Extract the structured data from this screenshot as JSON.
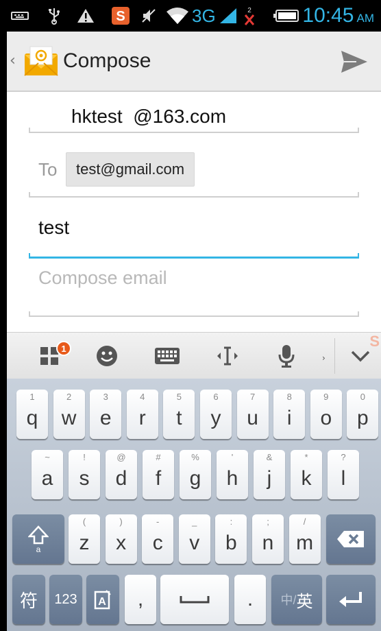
{
  "status_bar": {
    "network": "3G",
    "time": "10:45",
    "ampm": "AM"
  },
  "action_bar": {
    "title": "Compose",
    "app_icon": "email-app-icon",
    "action_icon": "send-icon"
  },
  "compose": {
    "from": "hktest  @163.com",
    "to_label": "To",
    "to_recipient": "test@gmail.com",
    "subject_value": "test",
    "body_placeholder": "Compose email"
  },
  "keyboard_toolbar": {
    "badge_count": "1",
    "tools": [
      "apps-icon",
      "emoji-icon",
      "keyboard-icon",
      "cursor-icon",
      "mic-icon",
      "chevron-down-icon"
    ]
  },
  "keyboard": {
    "row1": [
      {
        "sub": "1",
        "key": "q"
      },
      {
        "sub": "2",
        "key": "w"
      },
      {
        "sub": "3",
        "key": "e"
      },
      {
        "sub": "4",
        "key": "r"
      },
      {
        "sub": "5",
        "key": "t"
      },
      {
        "sub": "6",
        "key": "y"
      },
      {
        "sub": "7",
        "key": "u"
      },
      {
        "sub": "8",
        "key": "i"
      },
      {
        "sub": "9",
        "key": "o"
      },
      {
        "sub": "0",
        "key": "p"
      }
    ],
    "row2": [
      {
        "sub": "~",
        "key": "a"
      },
      {
        "sub": "!",
        "key": "s"
      },
      {
        "sub": "@",
        "key": "d"
      },
      {
        "sub": "#",
        "key": "f"
      },
      {
        "sub": "%",
        "key": "g"
      },
      {
        "sub": "'",
        "key": "h"
      },
      {
        "sub": "&",
        "key": "j"
      },
      {
        "sub": "*",
        "key": "k"
      },
      {
        "sub": "?",
        "key": "l"
      }
    ],
    "row3": [
      {
        "sub": "(",
        "key": "z"
      },
      {
        "sub": ")",
        "key": "x"
      },
      {
        "sub": "-",
        "key": "c"
      },
      {
        "sub": "_",
        "key": "v"
      },
      {
        "sub": ":",
        "key": "b"
      },
      {
        "sub": ";",
        "key": "n"
      },
      {
        "sub": "/",
        "key": "m"
      }
    ],
    "symbols_label": "符",
    "numbers_label": "123",
    "comma_label": ",",
    "period_label": ".",
    "lang_label_left": "中/",
    "lang_label_right": "英"
  }
}
